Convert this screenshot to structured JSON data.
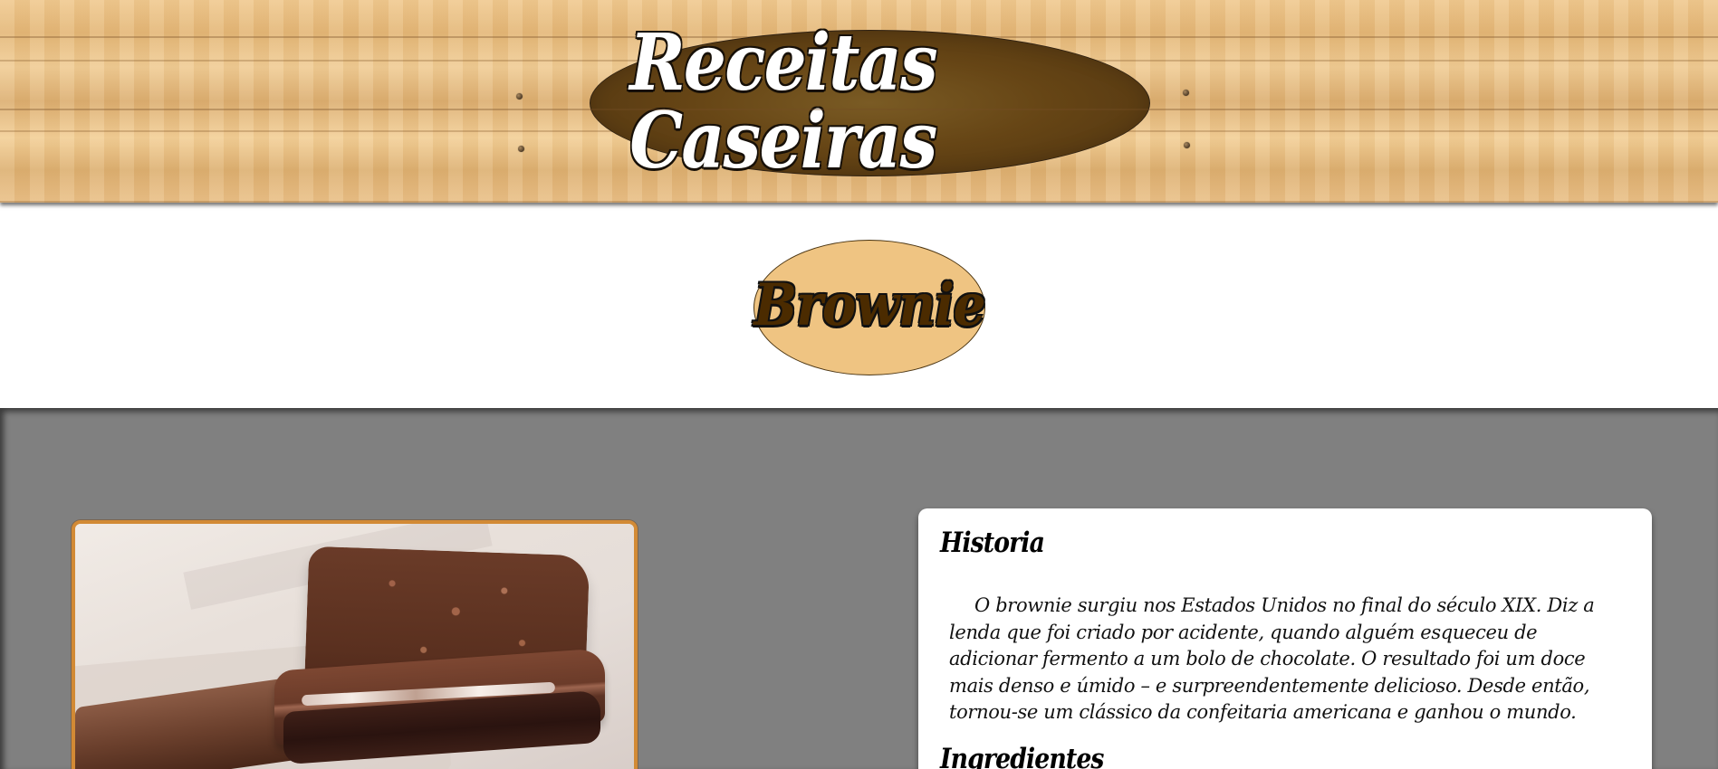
{
  "header": {
    "site_title": "Receitas Caseiras"
  },
  "recipe": {
    "title": "Brownie"
  },
  "content": {
    "history": {
      "heading": "Historia",
      "text": "O brownie surgiu nos Estados Unidos no final do século XIX. Diz a lenda que foi criado por acidente, quando alguém esqueceu de adicionar fermento a um bolo de chocolate. O resultado foi um doce mais denso e úmido – e surpreendentemente delicioso. Desde então, tornou-se um clássico da confeitaria americana e ganhou o mundo."
    },
    "ingredients": {
      "heading": "Ingredientes"
    }
  },
  "colors": {
    "header_wood": "#e8bd7f",
    "site_badge": "#664515",
    "recipe_badge": "#efc482",
    "content_background": "#808080",
    "image_border": "#d28a35",
    "card_background": "#ffffff"
  },
  "icons": []
}
